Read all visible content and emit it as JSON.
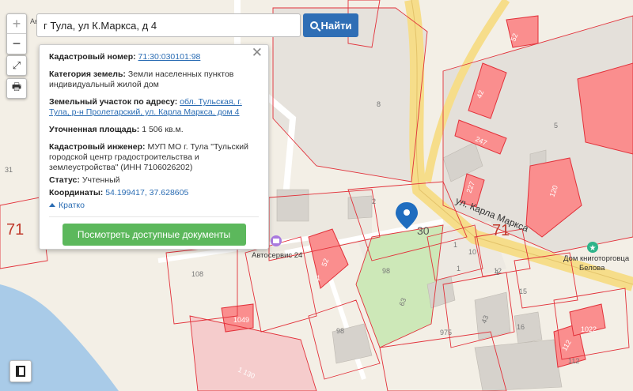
{
  "search": {
    "value": "г Тула, ул К.Маркса, д 4",
    "button_label": "Найти"
  },
  "zoom": {
    "in": "+",
    "out": "−"
  },
  "popup": {
    "cadastral_number_label": "Кадастровый номер:",
    "cadastral_number_value": "71:30:030101:98",
    "land_category_label": "Категория земель:",
    "land_category_value": "Земли населенных пунктов индивидуальный жилой дом",
    "address_label": "Земельный участок по адресу:",
    "address_value": "обл. Тульская, г. Тула, р-н Пролетарский, ул. Карла Маркса, дом 4",
    "area_label": "Уточненная площадь:",
    "area_value": "1 506 кв.м.",
    "engineer_label": "Кадастровый инженер:",
    "engineer_value": "МУП МО г. Тула \"Тульский городской центр градостроительства и землеустройства\" (ИНН 7106026202)",
    "status_label": "Статус:",
    "status_value": "Учтенный",
    "coords_label": "Координаты:",
    "coords_value": "54.199417, 37.628605",
    "toggle_label": "Кратко",
    "docs_button": "Посмотреть доступные документы"
  },
  "map_labels": {
    "street": "ул. Карла Маркса",
    "poi_autoservice": "Автосервис 24",
    "poi_bookstore": "Дом книготорговца Белова",
    "partial_top": "Авт",
    "block_71_left": "71",
    "block_71_right": "71",
    "block_30": "30",
    "parcel_numbers": [
      "8",
      "5",
      "31",
      "108",
      "2",
      "98",
      "63",
      "975",
      "98",
      "10",
      "12",
      "15",
      "16",
      "112",
      "43",
      "1",
      "1",
      "1"
    ],
    "building_numbers": [
      "52",
      "42",
      "247",
      "120",
      "227",
      "52",
      "122",
      "1",
      "1049",
      "1022",
      "112",
      "130"
    ]
  },
  "colors": {
    "parcel_fill": "#fa8e8e",
    "parcel_border": "#e2313a",
    "marker": "#1f6dbf",
    "water": "#a9cbe8",
    "green": "#cde8b8",
    "road_yellow": "#f6dd8a"
  }
}
